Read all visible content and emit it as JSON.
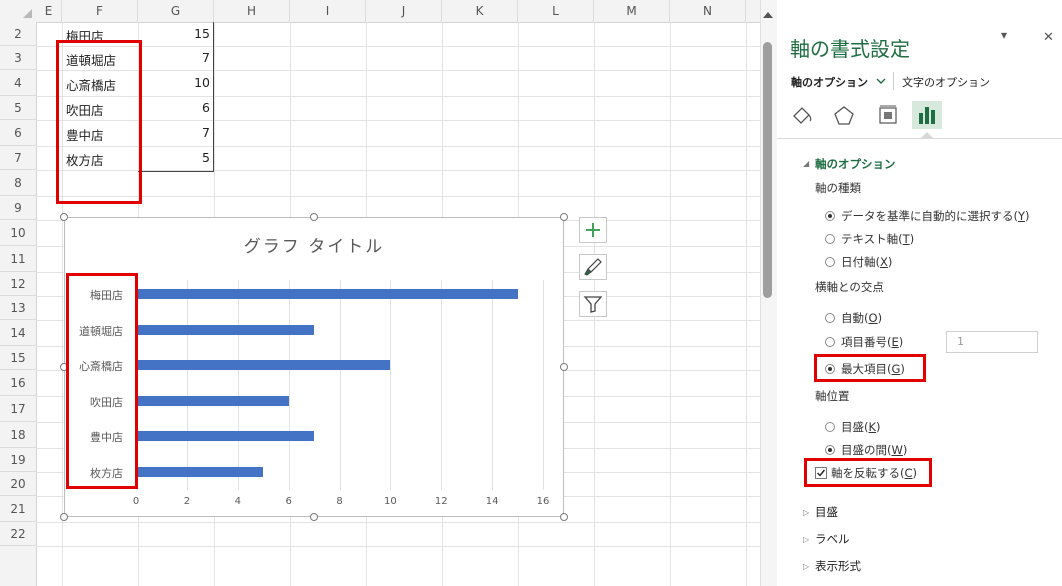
{
  "columns": [
    "E",
    "F",
    "G",
    "H",
    "I",
    "J",
    "K",
    "L",
    "M",
    "N"
  ],
  "rows": [
    "2",
    "3",
    "4",
    "5",
    "6",
    "7",
    "8",
    "9",
    "10",
    "11",
    "12",
    "13",
    "14",
    "15",
    "16",
    "17",
    "18",
    "19",
    "20",
    "21",
    "22"
  ],
  "table": [
    {
      "store": "梅田店",
      "count": "15"
    },
    {
      "store": "道頓堀店",
      "count": "7"
    },
    {
      "store": "心斎橋店",
      "count": "10"
    },
    {
      "store": "吹田店",
      "count": "6"
    },
    {
      "store": "豊中店",
      "count": "7"
    },
    {
      "store": "枚方店",
      "count": "5"
    }
  ],
  "chart_data": {
    "type": "bar",
    "orientation": "horizontal",
    "title": "グラフ タイトル",
    "categories": [
      "梅田店",
      "道頓堀店",
      "心斎橋店",
      "吹田店",
      "豊中店",
      "枚方店"
    ],
    "values": [
      15,
      7,
      10,
      6,
      7,
      5
    ],
    "xlim": [
      0,
      16
    ],
    "xticks": [
      "0",
      "2",
      "4",
      "6",
      "8",
      "10",
      "12",
      "14",
      "16"
    ],
    "grid": true,
    "bar_color": "#4472c4"
  },
  "chart_buttons": {
    "add_element": "+",
    "styles": "brush",
    "filter": "filter"
  },
  "pane": {
    "title": "軸の書式設定",
    "dropdown_icon": "▾",
    "close_icon": "✕",
    "tab_axis_options": "軸のオプション",
    "tab_text_options": "文字のオプション",
    "section_title": "軸のオプション",
    "axis_type_label": "軸の種類",
    "axis_type_opts": [
      "データを基準に自動的に選択する(Y)",
      "テキスト軸(T)",
      "日付軸(X)"
    ],
    "cross_label": "横軸との交点",
    "cross_opts": [
      "自動(O)",
      "項目番号(E)",
      "最大項目(G)"
    ],
    "cross_number_value": "1",
    "position_label": "軸位置",
    "position_opts": [
      "目盛(K)",
      "目盛の間(W)"
    ],
    "reverse_label": "軸を反転する(C)",
    "collapsed_sections": [
      "目盛",
      "ラベル",
      "表示形式"
    ],
    "accent_color": "#1f6e43",
    "highlight_color": "#e00000"
  }
}
